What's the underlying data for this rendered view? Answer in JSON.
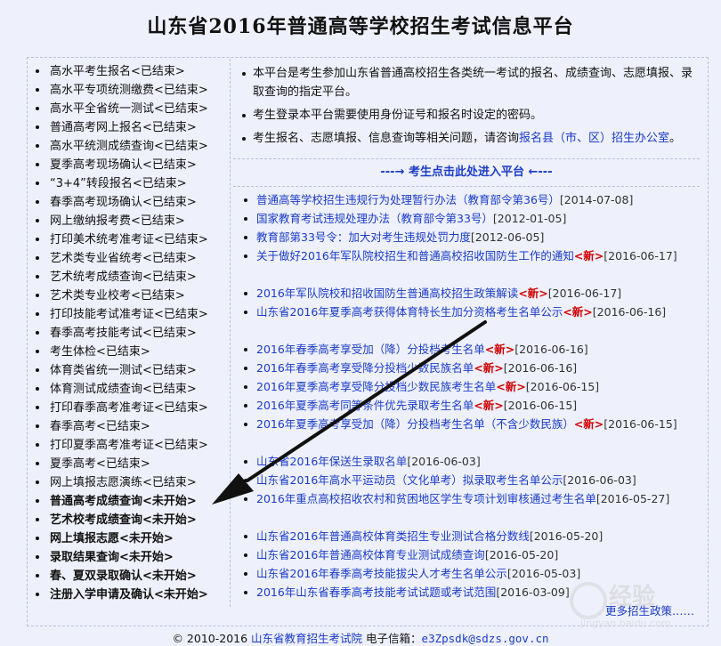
{
  "page": {
    "title": "山东省2016年普通高等学校招生考试信息平台"
  },
  "sidebar": {
    "items": [
      {
        "label": "高水平考生报名<已结束>",
        "bold": false
      },
      {
        "label": "高水平专项统测缴费<已结束>",
        "bold": false
      },
      {
        "label": "高水平全省统一测试<已结束>",
        "bold": false
      },
      {
        "label": "普通高考网上报名<已结束>",
        "bold": false
      },
      {
        "label": "高水平统测成绩查询<已结束>",
        "bold": false
      },
      {
        "label": "夏季高考现场确认<已结束>",
        "bold": false
      },
      {
        "label": "“3+4”转段报名<已结束>",
        "bold": false
      },
      {
        "label": "春季高考现场确认<已结束>",
        "bold": false
      },
      {
        "label": "网上缴纳报考费<已结束>",
        "bold": false
      },
      {
        "label": "打印美术统考准考证<已结束>",
        "bold": false
      },
      {
        "label": "艺术类专业省统考<已结束>",
        "bold": false
      },
      {
        "label": "艺术统考成绩查询<已结束>",
        "bold": false
      },
      {
        "label": "艺术类专业校考<已结束>",
        "bold": false
      },
      {
        "label": "打印技能考试准考证<已结束>",
        "bold": false
      },
      {
        "label": "春季高考技能考试<已结束>",
        "bold": false
      },
      {
        "label": "考生体检<已结束>",
        "bold": false
      },
      {
        "label": "体育类省统一测试<已结束>",
        "bold": false
      },
      {
        "label": "体育测试成绩查询<已结束>",
        "bold": false
      },
      {
        "label": "打印春季高考准考证<已结束>",
        "bold": false
      },
      {
        "label": "春季高考<已结束>",
        "bold": false
      },
      {
        "label": "打印夏季高考准考证<已结束>",
        "bold": false
      },
      {
        "label": "夏季高考<已结束>",
        "bold": false
      },
      {
        "label": "网上填报志愿演练<已结束>",
        "bold": false
      },
      {
        "label": "普通高考成绩查询<未开始>",
        "bold": true
      },
      {
        "label": "艺术校考成绩查询<未开始>",
        "bold": true
      },
      {
        "label": "网上填报志愿<未开始>",
        "bold": true
      },
      {
        "label": "录取结果查询<未开始>",
        "bold": true
      },
      {
        "label": "春、夏双录取确认<未开始>",
        "bold": true
      },
      {
        "label": "注册入学申请及确认<未开始>",
        "bold": true
      }
    ]
  },
  "notice": {
    "p1": "本平台是考生参加山东省普通高校招生各类统一考试的报名、成绩查询、志愿填报、录取查询的指定平台。",
    "p2": "考生登录本平台需要使用身份证号和报名时设定的密码。",
    "p3_text": "考生报名、志愿填报、信息查询等相关问题，请咨询",
    "p3_link": "报名县（市、区）招生办公室",
    "p3_end": "。"
  },
  "enter": {
    "label": "---→  考生点击此处进入平台  ←---"
  },
  "news": {
    "items": [
      {
        "title": "普通高等学校招生违规行为处理暂行办法（教育部令第36号）",
        "new": "",
        "date": "[2014-07-08]",
        "two": false
      },
      {
        "title": "国家教育考试违规处理办法（教育部令第33号）",
        "new": "",
        "date": "[2012-01-05]",
        "two": false
      },
      {
        "title": "教育部第33号令：加大对考生违规处罚力度",
        "new": "",
        "date": "[2012-06-05]",
        "two": false
      },
      {
        "title": "关于做好2016年军队院校招生和普通高校招收国防生工作的通知",
        "new": "<新>",
        "date": "[2016-06-17]",
        "two": true
      },
      {
        "title": "2016年军队院校和招收国防生普通高校招生政策解读",
        "new": "<新>",
        "date": "[2016-06-17]",
        "two": false
      },
      {
        "title": "山东省2016年夏季高考获得体育特长生加分资格考生名单公示",
        "new": "<新>",
        "date": "[2016-06-16]",
        "two": true
      },
      {
        "title": "2016年春季高考享受加（降）分投档考生名单",
        "new": "<新>",
        "date": "[2016-06-16]",
        "two": false
      },
      {
        "title": "2016年春季高考享受降分投档少数民族名单",
        "new": "<新>",
        "date": "[2016-06-16]",
        "two": false
      },
      {
        "title": "2016年夏季高考享受降分投档少数民族考生名单",
        "new": "<新>",
        "date": "[2016-06-15]",
        "two": false
      },
      {
        "title": "2016年夏季高考同等条件优先录取考生名单",
        "new": "<新>",
        "date": "[2016-06-15]",
        "two": false
      },
      {
        "title": "2016年夏季高考享受加（降）分投档考生名单（不含少数民族）",
        "new": "<新>",
        "date": "[2016-06-15]",
        "two": true
      },
      {
        "title": "山东省2016年保送生录取名单",
        "new": "",
        "date": "[2016-06-03]",
        "two": false
      },
      {
        "title": "山东省2016年高水平运动员（文化单考）拟录取考生名单公示",
        "new": "",
        "date": "[2016-06-03]",
        "two": false
      },
      {
        "title": "2016年重点高校招收农村和贫困地区学生专项计划审核通过考生名单",
        "new": "",
        "date": "[2016-05-27]",
        "two": true
      },
      {
        "title": "山东省2016年普通高校体育类招生专业测试合格分数线",
        "new": "",
        "date": "[2016-05-20]",
        "two": false
      },
      {
        "title": "山东省2016年普通高校体育专业测试成绩查询",
        "new": "",
        "date": "[2016-05-20]",
        "two": false
      },
      {
        "title": "山东省2016年春季高考技能拔尖人才考生名单公示",
        "new": "",
        "date": "[2016-05-03]",
        "two": false
      },
      {
        "title": "2016年山东省春季高考技能考试试题或考试范围",
        "new": "",
        "date": "[2016-03-09]",
        "two": false
      }
    ],
    "more": "更多招生政策……"
  },
  "footer": {
    "copyright": "© 2010-2016 ",
    "org": "山东省教育招生考试院",
    "mail_label": " 电子信箱：",
    "mail": "e3Zpsdk@sdzs.gov.cn"
  },
  "watermark": {
    "text": "经验",
    "url": "jingyan.baidu.com"
  },
  "colors": {
    "link": "#1a3cc7",
    "new_badge": "#d10000",
    "background": "#eef0fb"
  }
}
